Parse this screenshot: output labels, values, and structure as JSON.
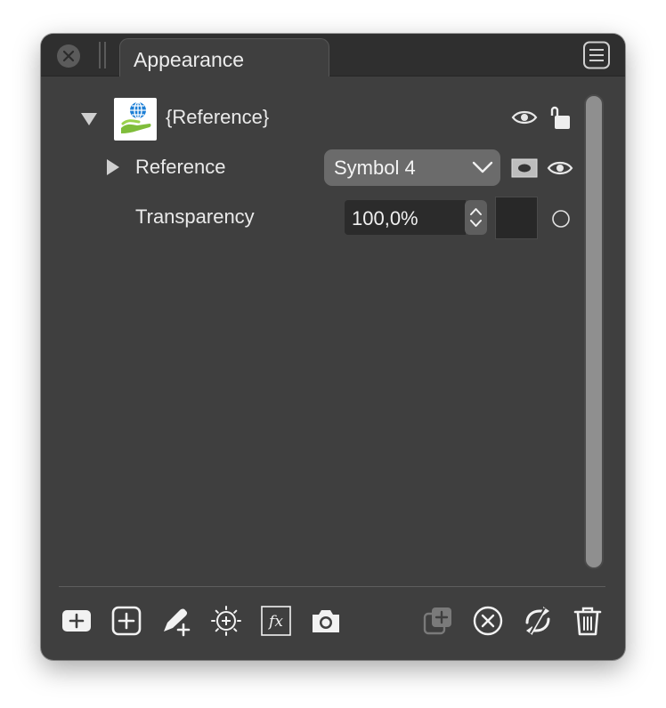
{
  "panel": {
    "tab_title": "Appearance"
  },
  "tree": {
    "root": {
      "label": "{Reference}",
      "expanded": true,
      "thumbnail_icon": "globe-in-hand-icon",
      "visible": true,
      "locked": false
    },
    "reference_row": {
      "label": "Reference",
      "expanded": false,
      "symbol_popup": {
        "selected": "Symbol 4"
      },
      "visible": true
    },
    "transparency_row": {
      "label": "Transparency",
      "value": "100,0%",
      "swatch_color": "#282828"
    }
  },
  "toolbar": {
    "left_icons": [
      "add-icon",
      "add-square-icon",
      "add-brush-icon",
      "add-target-icon",
      "fx-icon",
      "camera-icon"
    ],
    "right_icons": [
      "duplicate-icon",
      "clear-icon",
      "sync-icon",
      "trash-icon"
    ]
  },
  "colors": {
    "panel_bg": "#3f3f3f",
    "titlebar_bg": "#2f2f2f",
    "text": "#eaeaea",
    "popup_bg": "#6b6b6b",
    "scroll_thumb": "#8f8f8f"
  }
}
